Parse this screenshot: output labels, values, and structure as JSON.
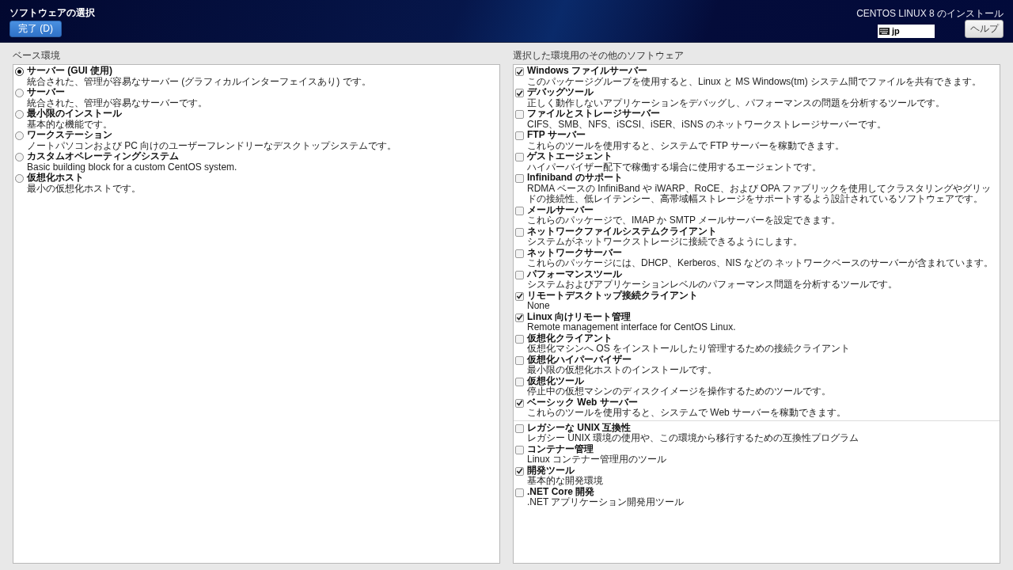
{
  "header": {
    "title": "ソフトウェアの選択",
    "done_button": "完了 (D)",
    "installer_title": "CENTOS LINUX 8 のインストール",
    "keyboard_layout": "jp",
    "help_button": "ヘルプ"
  },
  "base_environment": {
    "heading": "ベース環境",
    "options": [
      {
        "name": "サーバー (GUI 使用)",
        "description": "統合された、管理が容易なサーバー (グラフィカルインターフェイスあり) です。",
        "selected": true
      },
      {
        "name": "サーバー",
        "description": "統合された、管理が容易なサーバーです。",
        "selected": false
      },
      {
        "name": "最小限のインストール",
        "description": "基本的な機能です。",
        "selected": false
      },
      {
        "name": "ワークステーション",
        "description": "ノートパソコンおよび PC 向けのユーザーフレンドリーなデスクトップシステムです。",
        "selected": false
      },
      {
        "name": "カスタムオペレーティングシステム",
        "description": "Basic building block for a custom CentOS system.",
        "selected": false
      },
      {
        "name": "仮想化ホスト",
        "description": "最小の仮想化ホストです。",
        "selected": false
      }
    ]
  },
  "additional_software": {
    "heading": "選択した環境用のその他のソフトウェア",
    "groups": [
      {
        "items": [
          {
            "name": "Windows ファイルサーバー",
            "description": "このパッケージグループを使用すると、Linux と MS Windows(tm) システム間でファイルを共有できます。",
            "checked": true
          },
          {
            "name": "デバッグツール",
            "description": "正しく動作しないアプリケーションをデバッグし、パフォーマンスの問題を分析するツールです。",
            "checked": true
          },
          {
            "name": "ファイルとストレージサーバー",
            "description": "CIFS、SMB、NFS、iSCSI、iSER、iSNS のネットワークストレージサーバーです。",
            "checked": false
          },
          {
            "name": "FTP サーバー",
            "description": "これらのツールを使用すると、システムで FTP サーバーを稼動できます。",
            "checked": false
          },
          {
            "name": "ゲストエージェント",
            "description": "ハイパーバイザー配下で稼働する場合に使用するエージェントです。",
            "checked": false
          },
          {
            "name": "Infiniband のサポート",
            "description": "RDMA ベースの InfiniBand や iWARP、RoCE、および OPA ファブリックを使用してクラスタリングやグリッドの接続性、低レイテンシー、高帯域幅ストレージをサポートするよう設計されているソフトウェアです。",
            "checked": false
          },
          {
            "name": "メールサーバー",
            "description": "これらのパッケージで、IMAP か SMTP メールサーバーを設定できます。",
            "checked": false
          },
          {
            "name": "ネットワークファイルシステムクライアント",
            "description": "システムがネットワークストレージに接続できるようにします。",
            "checked": false
          },
          {
            "name": "ネットワークサーバー",
            "description": "これらのパッケージには、DHCP、Kerberos、NIS などの ネットワークベースのサーバーが含まれています。",
            "checked": false
          },
          {
            "name": "パフォーマンスツール",
            "description": "システムおよびアプリケーションレベルのパフォーマンス問題を分析するツールです。",
            "checked": false
          },
          {
            "name": "リモートデスクトップ接続クライアント",
            "description": "None",
            "checked": true
          },
          {
            "name": "Linux 向けリモート管理",
            "description": "Remote management interface for CentOS Linux.",
            "checked": true
          },
          {
            "name": "仮想化クライアント",
            "description": "仮想化マシンへ OS をインストールしたり管理するための接続クライアント",
            "checked": false
          },
          {
            "name": "仮想化ハイパーバイザー",
            "description": "最小限の仮想化ホストのインストールです。",
            "checked": false
          },
          {
            "name": "仮想化ツール",
            "description": "停止中の仮想マシンのディスクイメージを操作するためのツールです。",
            "checked": false
          },
          {
            "name": "ベーシック Web サーバー",
            "description": "これらのツールを使用すると、システムで Web サーバーを稼動できます。",
            "checked": true
          }
        ]
      },
      {
        "items": [
          {
            "name": "レガシーな UNIX 互換性",
            "description": "レガシー UNIX 環境の使用や、この環境から移行するための互換性プログラム",
            "checked": false
          },
          {
            "name": "コンテナー管理",
            "description": "Linux コンテナー管理用のツール",
            "checked": false
          },
          {
            "name": "開発ツール",
            "description": "基本的な開発環境",
            "checked": true
          },
          {
            "name": ".NET Core 開発",
            "description": ".NET アプリケーション開発用ツール",
            "checked": false
          }
        ]
      }
    ]
  }
}
